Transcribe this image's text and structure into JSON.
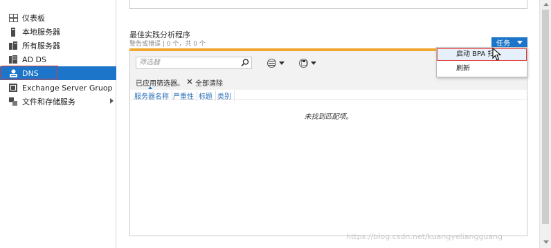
{
  "sidebar": {
    "items": [
      {
        "label": "仪表板",
        "icon": "dashboard-icon"
      },
      {
        "label": "本地服务器",
        "icon": "server-icon"
      },
      {
        "label": "所有服务器",
        "icon": "servers-icon"
      },
      {
        "label": "AD DS",
        "icon": "ad-ds-icon"
      },
      {
        "label": "DNS",
        "icon": "dns-icon"
      },
      {
        "label": "Exchange Server Gruop",
        "icon": "exchange-icon"
      },
      {
        "label": "文件和存储服务",
        "icon": "storage-icon"
      }
    ],
    "selected": "DNS"
  },
  "bpa": {
    "title": "最佳实践分析程序",
    "subtitle": "警告或错误 | 0 个，共 0 个",
    "tasks_label": "任务",
    "filter_placeholder": "筛选器",
    "applied_label": "已应用筛选器。",
    "clear_all_label": "全部清除",
    "columns": [
      "服务器名称",
      "严重性",
      "标题",
      "类别"
    ],
    "no_match": "未找到匹配项。"
  },
  "menu": {
    "items": [
      "启动 BPA 扫",
      "刷新"
    ]
  },
  "watermark": "https://blog.csdn.net/kuangyeliangguang",
  "colors": {
    "accent": "#1c75c8",
    "orange": "#f0a830",
    "highlight_border": "#e03a3a"
  }
}
